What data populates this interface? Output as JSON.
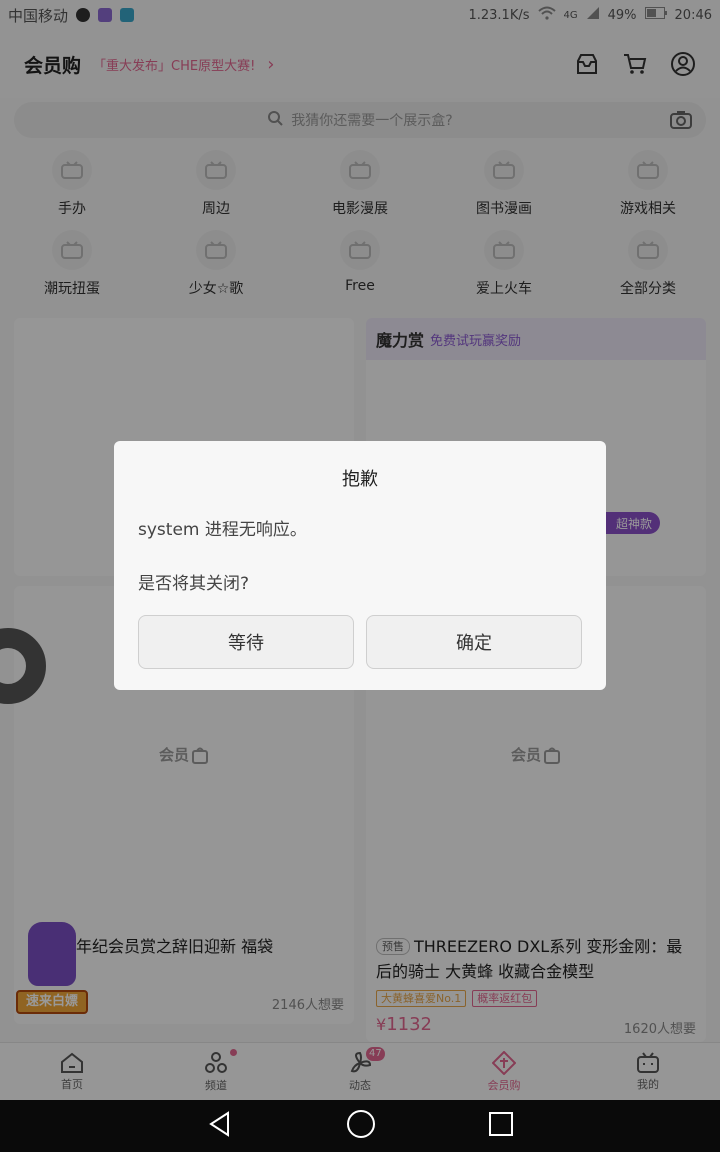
{
  "status_bar": {
    "carrier": "中国移动",
    "speed": "1.23.1K/s",
    "network": "4G",
    "battery": "49%",
    "time": "20:46"
  },
  "header": {
    "title": "会员购",
    "promo": "「重大发布」CHE原型大赛!",
    "icons": [
      "inbox-icon",
      "cart-icon",
      "profile-icon"
    ]
  },
  "search": {
    "placeholder": "我猜你还需要一个展示盒?"
  },
  "categories": [
    {
      "label": "手办"
    },
    {
      "label": "周边"
    },
    {
      "label": "电影漫展"
    },
    {
      "label": "图书漫画"
    },
    {
      "label": "游戏相关"
    },
    {
      "label": "潮玩扭蛋"
    },
    {
      "label": "少女☆歌"
    },
    {
      "label": "Free"
    },
    {
      "label": "爱上火车"
    },
    {
      "label": "全部分类"
    }
  ],
  "cards": {
    "magic_banner_title": "魔力赏",
    "magic_banner_sub": "免费试玩赢奖励",
    "pill_text": "超神款",
    "placeholder_logo": "会员",
    "card_c_title": "拜年纪会员赏之辞旧迎新 福袋",
    "card_c_wants": "2146人想要",
    "floating_badge_text": "速来白嫖",
    "card_d_presale": "预售",
    "card_d_title": "THREEZERO DXL系列 变形金刚：最后的骑士 大黄蜂 收藏合金模型",
    "card_d_tags": [
      "大黄蜂喜爱No.1",
      "概率返红包"
    ],
    "card_d_price_symbol": "¥",
    "card_d_price": "1132",
    "card_d_wants": "1620人想要"
  },
  "bottom_nav": [
    {
      "label": "首页"
    },
    {
      "label": "频道"
    },
    {
      "label": "动态",
      "badge": "47"
    },
    {
      "label": "会员购"
    },
    {
      "label": "我的"
    }
  ],
  "dialog": {
    "title": "抱歉",
    "message": "system 进程无响应。",
    "question": "是否将其关闭?",
    "wait_label": "等待",
    "ok_label": "确定"
  },
  "colors": {
    "accent": "#e2668f",
    "purple": "#8a50c8"
  }
}
